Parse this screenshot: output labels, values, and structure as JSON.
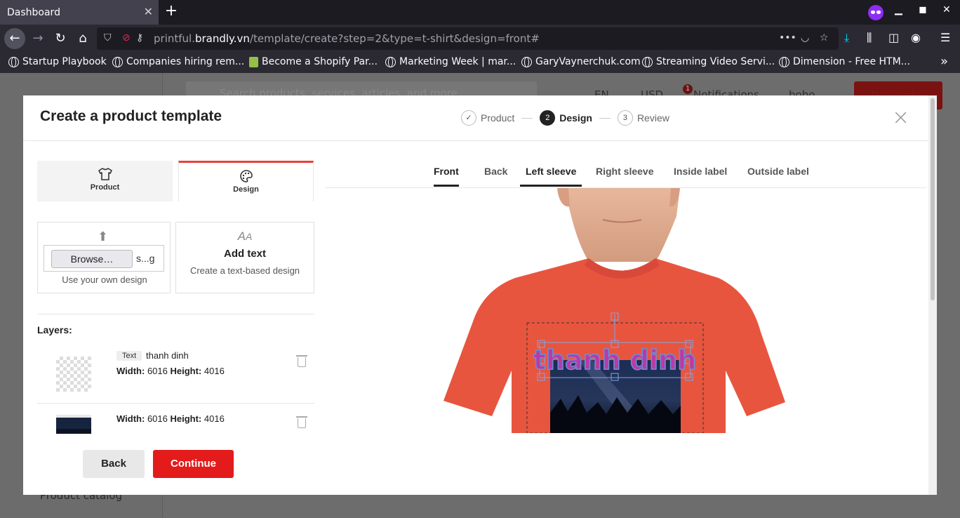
{
  "browser": {
    "tab_title": "Dashboard",
    "tab_close": "✕",
    "new_tab": "+",
    "url_prefix": "printful.",
    "url_host": "brandly.vn",
    "url_path": "/template/create?step=2&type=t-shirt&design=front#",
    "bookmarks": [
      "Startup Playbook",
      "Companies hiring rem...",
      "Become a Shopify Par...",
      "Marketing Week | mar...",
      "GaryVaynerchuk.com",
      "Streaming Video Servi...",
      "Dimension - Free HTM..."
    ],
    "overflow": "»"
  },
  "background_page": {
    "search_placeholder": "Search products, services, articles, and more...",
    "lang": "EN",
    "currency": "USD",
    "notifications": "Notifications",
    "notification_count": "1",
    "user": "bobo",
    "new_order": "New order",
    "product_catalog": "Product catalog"
  },
  "modal": {
    "title": "Create a product template",
    "steps": [
      {
        "label": "Product",
        "marker": "✓"
      },
      {
        "label": "Design",
        "marker": "2"
      },
      {
        "label": "Review",
        "marker": "3"
      }
    ],
    "close": "×",
    "panel_tabs": [
      "Product",
      "Design"
    ],
    "upload": {
      "browse": "Browse…",
      "file_name": "s...g",
      "label": "Use your own design"
    },
    "add_text": {
      "title": "Add text",
      "subtitle": "Create a text-based design"
    },
    "layers_title": "Layers:",
    "layers": [
      {
        "tag": "Text",
        "name": "thanh dinh",
        "width_label": "Width:",
        "width": "6016",
        "height_label": "Height:",
        "height": "4016"
      },
      {
        "width_label": "Width:",
        "width": "6016",
        "height_label": "Height:",
        "height": "4016"
      }
    ],
    "buttons": {
      "back": "Back",
      "continue": "Continue"
    },
    "view_tabs": [
      "Front",
      "Back",
      "Left sleeve",
      "Right sleeve",
      "Inside label",
      "Outside label"
    ],
    "design_text": "thanh dinh",
    "colors": {
      "accent": "#e31b1b",
      "shirt": "#e8553f",
      "design_text": "#b93aa6"
    }
  }
}
